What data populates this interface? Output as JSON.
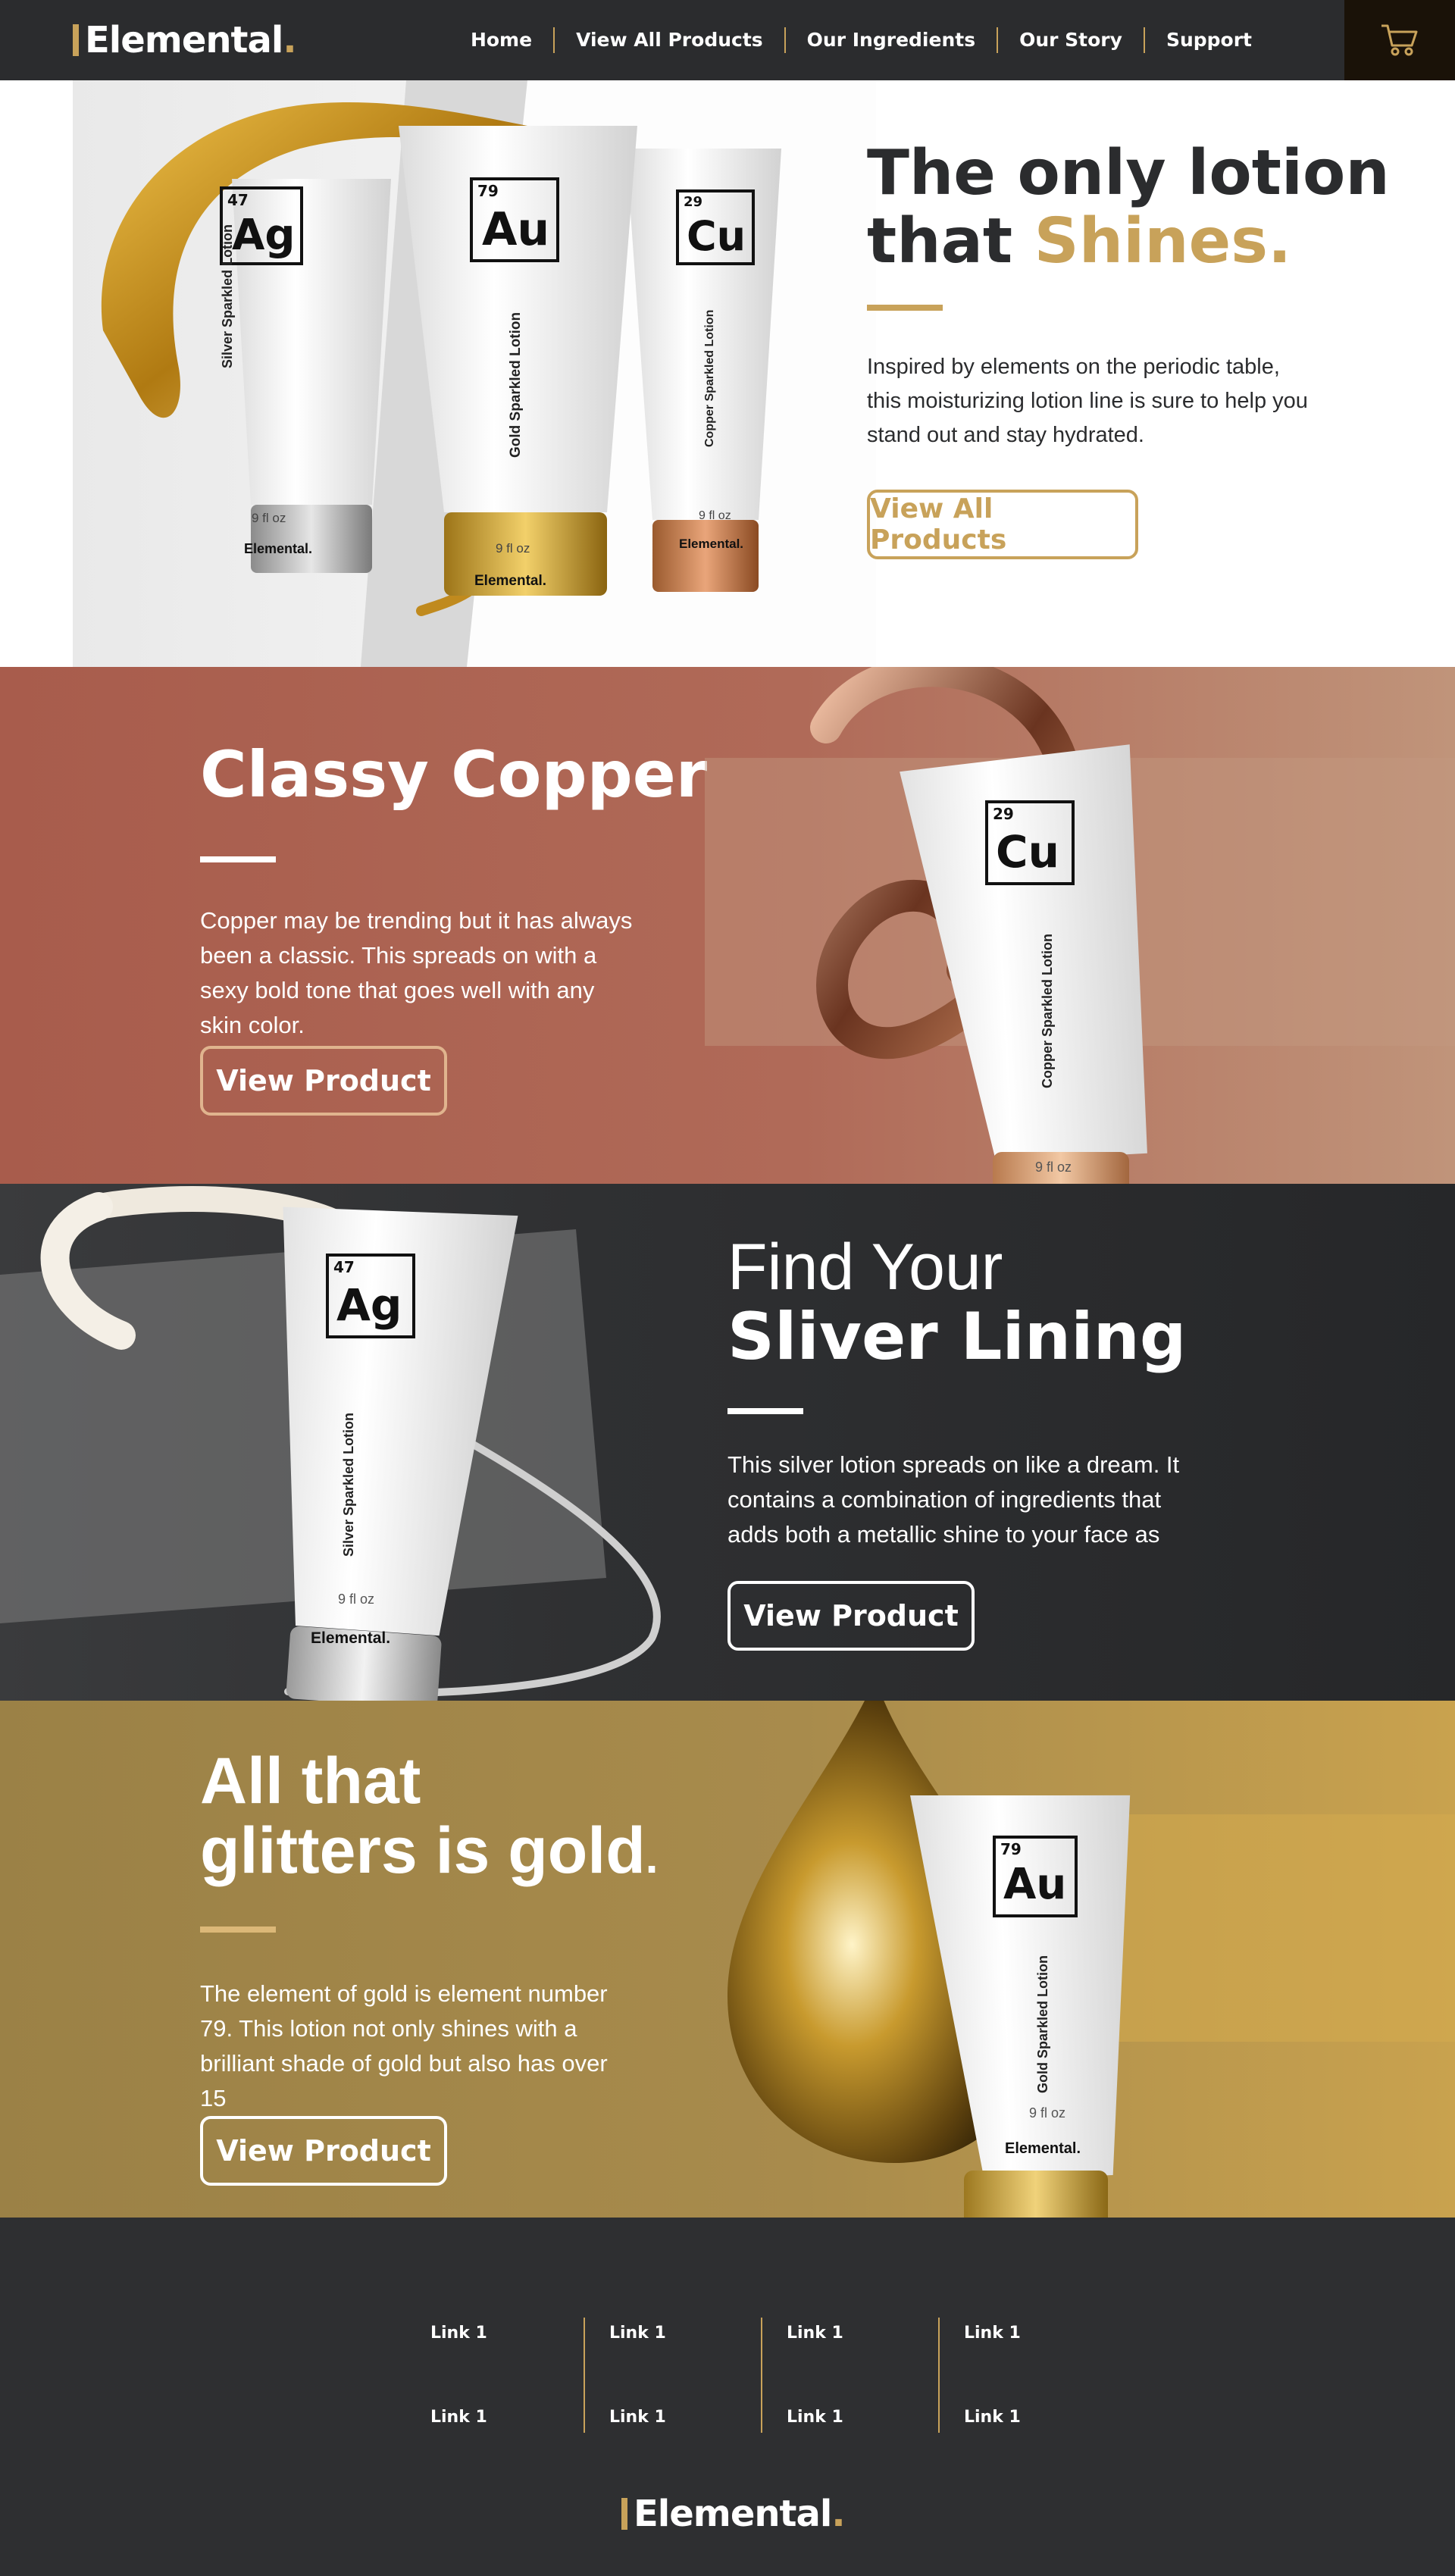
{
  "nav": {
    "logo": "Elemental",
    "logo_dot": ".",
    "links": [
      "Home",
      "View All Products",
      "Our Ingredients",
      "Our Story",
      "Support"
    ]
  },
  "hero": {
    "title_line1": "The only lotion",
    "title_line2_prefix": "that ",
    "title_highlight": "Shines",
    "title_dot": ".",
    "description": "Inspired by elements on the periodic table, this moisturizing lotion line is sure to help you stand out and stay hydrated.",
    "button": "View All Products"
  },
  "products": {
    "silver": {
      "number": "47",
      "symbol": "Ag",
      "name": "Silver Sparkled Lotion",
      "size": "9 fl oz",
      "brand": "Elemental."
    },
    "gold": {
      "number": "79",
      "symbol": "Au",
      "name": "Gold Sparkled Lotion",
      "size": "9 fl oz",
      "brand": "Elemental."
    },
    "copper": {
      "number": "29",
      "symbol": "Cu",
      "name": "Copper Sparkled Lotion",
      "size": "9 fl oz",
      "brand": "Elemental."
    }
  },
  "copper_section": {
    "title": "Classy Copper",
    "description": "Copper may be trending but it has always been a classic. This spreads on with a sexy bold tone that goes well with any skin color.",
    "button": "View Product"
  },
  "silver_section": {
    "title_line1": "Find Your",
    "title_line2": "Sliver Lining",
    "description": "This silver lotion spreads on like a dream. It contains a combination of ingredients that adds both a metallic shine to your face as",
    "button": "View Product"
  },
  "gold_section": {
    "title_line1": "All that",
    "title_line2_prefix": "glitters is ",
    "title_bold": "gold",
    "title_dot": ".",
    "description": "The element of gold is element number 79. This lotion not only shines with a brilliant shade of gold but also has over 15",
    "button": "View Product"
  },
  "footer": {
    "links": [
      "Link 1",
      "Link 1",
      "Link 1",
      "Link 1",
      "Link 1",
      "Link 1",
      "Link 1",
      "Link 1"
    ],
    "logo": "Elemental",
    "logo_dot": "."
  },
  "colors": {
    "accent_gold": "#c8a25a",
    "dark": "#2b2c2e",
    "copper": "#a85c4c",
    "gold_bg": "#9b8146"
  },
  "icons": {
    "cart": "cart-icon"
  }
}
